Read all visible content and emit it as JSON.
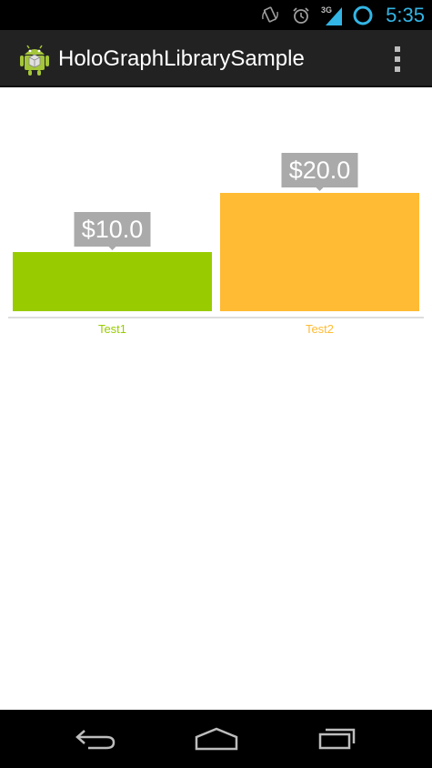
{
  "status_bar": {
    "time": "5:35",
    "network": "3G",
    "icons": [
      "rotate-icon",
      "alarm-icon",
      "signal-icon",
      "sync-icon"
    ]
  },
  "action_bar": {
    "title": "HoloGraphLibrarySample",
    "app_icon": "android-icon",
    "overflow_icon": "overflow-menu-icon"
  },
  "chart_data": {
    "type": "bar",
    "categories": [
      "Test1",
      "Test2"
    ],
    "values": [
      10.0,
      20.0
    ],
    "value_labels": [
      "$10.0",
      "$20.0"
    ],
    "colors": [
      "#99cc00",
      "#ffbb33"
    ],
    "label_bg": "#aaaaaa",
    "axis_color": "#bbbbbb",
    "grid": false,
    "ylim": [
      0,
      20
    ]
  },
  "nav_bar": {
    "back_icon": "back-icon",
    "home_icon": "home-icon",
    "recents_icon": "recent-apps-icon"
  }
}
